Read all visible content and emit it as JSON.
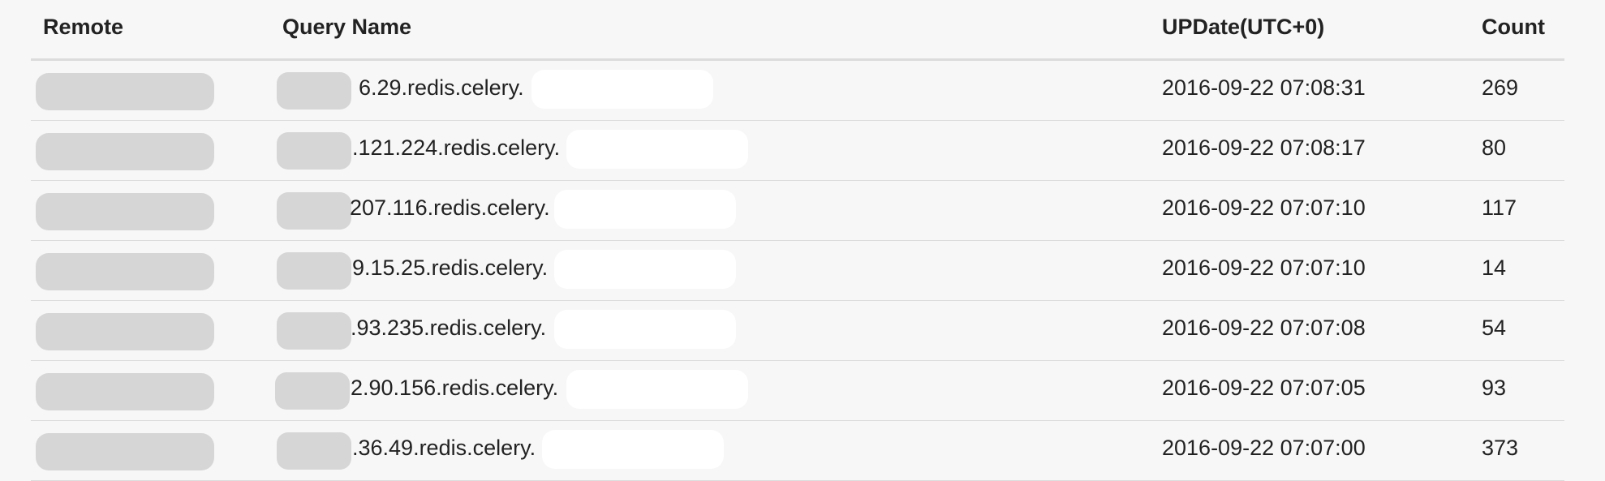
{
  "table": {
    "headers": {
      "remote": "Remote",
      "query_name": "Query Name",
      "update": "UPDate(UTC+0)",
      "count": "Count"
    },
    "rows": [
      {
        "query": "6.29.redis.celery.",
        "date": "2016-09-22 07:08:31",
        "count": "269"
      },
      {
        "query": ".121.224.redis.celery.",
        "date": "2016-09-22 07:08:17",
        "count": "80"
      },
      {
        "query": "207.116.redis.celery.",
        "date": "2016-09-22 07:07:10",
        "count": "117"
      },
      {
        "query": "9.15.25.redis.celery.",
        "date": "2016-09-22 07:07:10",
        "count": "14"
      },
      {
        "query": ".93.235.redis.celery.",
        "date": "2016-09-22 07:07:08",
        "count": "54"
      },
      {
        "query": "2.90.156.redis.celery.",
        "date": "2016-09-22 07:07:05",
        "count": "93"
      },
      {
        "query": ".36.49.redis.celery.",
        "date": "2016-09-22 07:07:00",
        "count": "373"
      }
    ]
  }
}
